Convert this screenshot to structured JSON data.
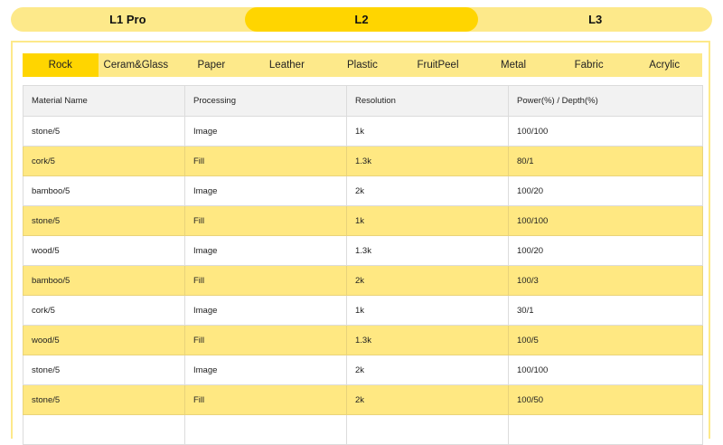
{
  "model_tabs": {
    "items": [
      {
        "label": "L1 Pro",
        "active": false
      },
      {
        "label": "L2",
        "active": true
      },
      {
        "label": "L3",
        "active": false
      }
    ]
  },
  "material_tabs": {
    "items": [
      {
        "label": "Rock",
        "active": true
      },
      {
        "label": "Ceram&Glass",
        "active": false
      },
      {
        "label": "Paper",
        "active": false
      },
      {
        "label": "Leather",
        "active": false
      },
      {
        "label": "Plastic",
        "active": false
      },
      {
        "label": "FruitPeel",
        "active": false
      },
      {
        "label": "Metal",
        "active": false
      },
      {
        "label": "Fabric",
        "active": false
      },
      {
        "label": "Acrylic",
        "active": false
      }
    ]
  },
  "table": {
    "headers": [
      "Material Name",
      "Processing",
      "Resolution",
      "Power(%) / Depth(%)"
    ],
    "rows": [
      [
        "stone/5",
        "Image",
        "1k",
        "100/100"
      ],
      [
        "cork/5",
        "Fill",
        "1.3k",
        "80/1"
      ],
      [
        "bamboo/5",
        "Image",
        "2k",
        "100/20"
      ],
      [
        "stone/5",
        "Fill",
        "1k",
        "100/100"
      ],
      [
        "wood/5",
        "Image",
        "1.3k",
        "100/20"
      ],
      [
        "bamboo/5",
        "Fill",
        "2k",
        "100/3"
      ],
      [
        "cork/5",
        "Image",
        "1k",
        "30/1"
      ],
      [
        "wood/5",
        "Fill",
        "1.3k",
        "100/5"
      ],
      [
        "stone/5",
        "Image",
        "2k",
        "100/100"
      ],
      [
        "stone/5",
        "Fill",
        "2k",
        "100/50"
      ]
    ]
  },
  "colors": {
    "accent": "#ffd500",
    "light_accent": "#fde98a",
    "row_highlight": "#ffe882",
    "header_bg": "#f2f2f2"
  }
}
